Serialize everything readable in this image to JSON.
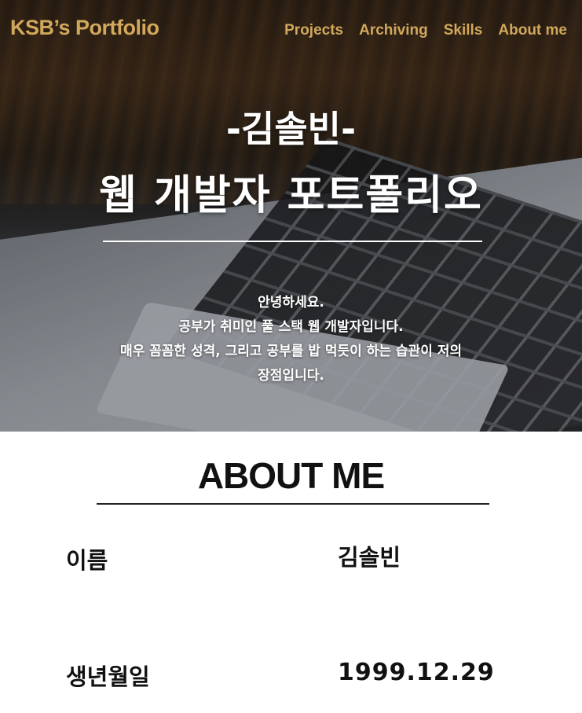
{
  "header": {
    "logo": "KSB’s Portfolio",
    "nav": [
      "Projects",
      "Archiving",
      "Skills",
      "About me"
    ]
  },
  "hero": {
    "title_line1": "-김솔빈-",
    "title_line2": "웹 개발자 포트폴리오",
    "intro_lines": [
      "안녕하세요.",
      "공부가 취미인 풀 스택 웹 개발자입니다.",
      "매우 꼼꼼한 성격, 그리고 공부를 밥 먹듯이 하는 습관이 저의",
      "장점입니다."
    ]
  },
  "about": {
    "title": "ABOUT ME",
    "rows": [
      {
        "label": "이름",
        "value": "김솔빈"
      },
      {
        "label": "생년월일",
        "value": "1999.12.29"
      }
    ]
  },
  "colors": {
    "nav_gold": "#d1a85c",
    "hero_text": "#ffffff",
    "about_text": "#111111"
  }
}
